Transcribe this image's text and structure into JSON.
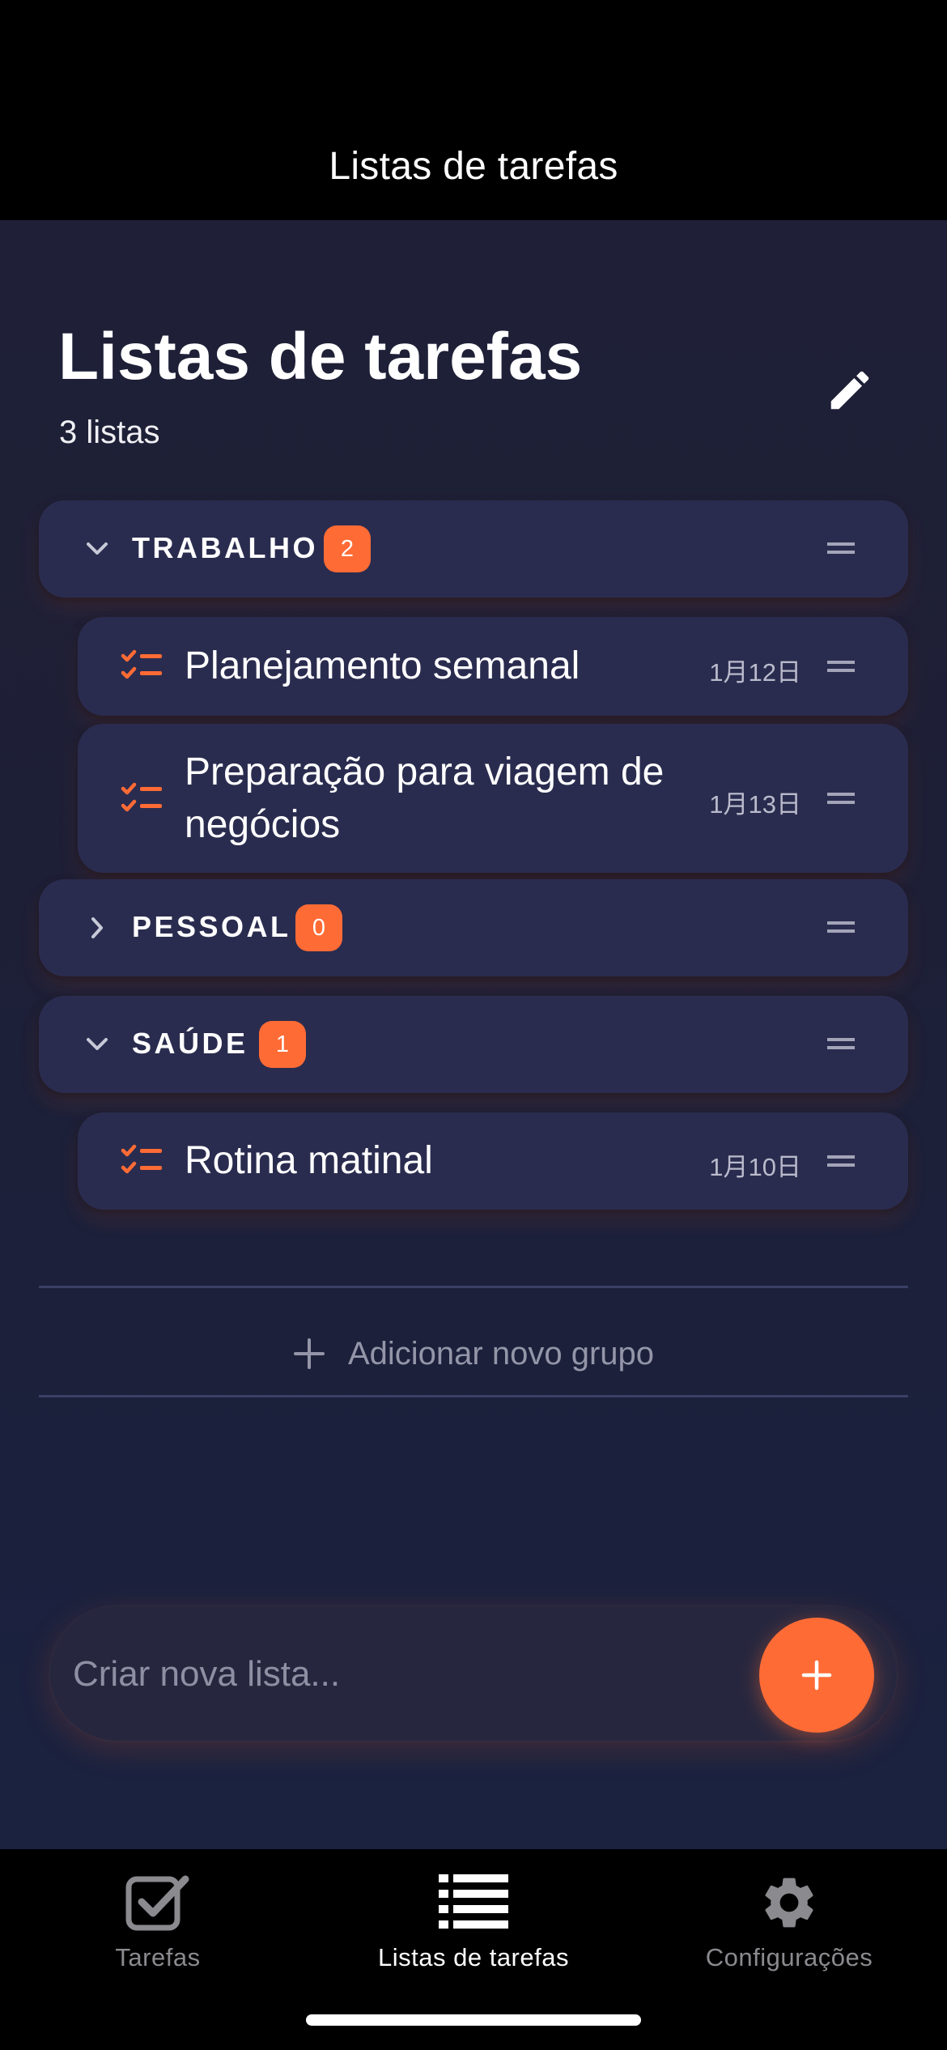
{
  "nav_bar": {
    "title": "Listas de tarefas"
  },
  "header": {
    "title": "Listas de tarefas",
    "subtitle": "3 listas"
  },
  "groups": [
    {
      "name": "TRABALHO",
      "count": "2",
      "expanded": true,
      "lists": [
        {
          "name": "Planejamento semanal",
          "date": "1月12日"
        },
        {
          "name_line1": "Preparação para viagem de",
          "name_line2": "negócios",
          "date": "1月13日"
        }
      ]
    },
    {
      "name": "PESSOAL",
      "count": "0",
      "expanded": false,
      "lists": []
    },
    {
      "name": "SAÚDE",
      "count": "1",
      "expanded": true,
      "lists": [
        {
          "name": "Rotina matinal",
          "date": "1月10日"
        }
      ]
    }
  ],
  "add_group": {
    "label": "Adicionar novo grupo"
  },
  "composer": {
    "placeholder": "Criar nova lista..."
  },
  "tabs": [
    {
      "label": "Tarefas",
      "icon": "checkbox-icon",
      "active": false
    },
    {
      "label": "Listas de tarefas",
      "icon": "list-icon",
      "active": true
    },
    {
      "label": "Configurações",
      "icon": "gear-icon",
      "active": false
    }
  ],
  "colors": {
    "accent": "#ff6b35",
    "card": "#2a2c4f",
    "background": "#1f2037",
    "inactive_tab": "#8a8a8f"
  }
}
